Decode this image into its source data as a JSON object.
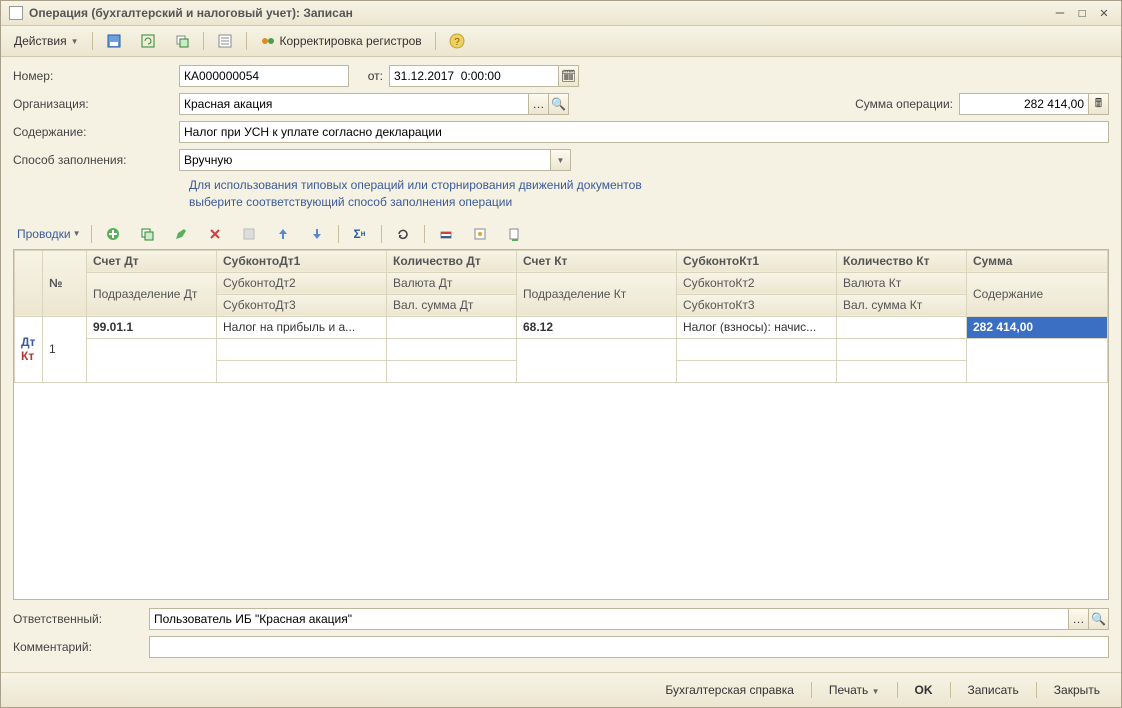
{
  "window": {
    "title": "Операция (бухгалтерский и налоговый учет): Записан"
  },
  "toolbar": {
    "actions": "Действия",
    "registers": "Корректировка регистров"
  },
  "form": {
    "number_label": "Номер:",
    "number_value": "КА000000054",
    "from_label": "от:",
    "date_value": "31.12.2017  0:00:00",
    "org_label": "Организация:",
    "org_value": "Красная акация",
    "sum_label": "Сумма операции:",
    "sum_value": "282 414,00",
    "content_label": "Содержание:",
    "content_value": "Налог при УСН к уплате согласно декларации",
    "fill_label": "Способ заполнения:",
    "fill_value": "Вручную",
    "hint1": "Для использования типовых операций или сторнирования движений документов",
    "hint2": "выберите соответствующий способ заполнения операции"
  },
  "gridtb": {
    "entries": "Проводки"
  },
  "grid": {
    "h_num": "№",
    "h_acc_dt": "Счет Дт",
    "h_sub_dt1": "СубконтоДт1",
    "h_qty_dt": "Количество Дт",
    "h_acc_kt": "Счет Кт",
    "h_sub_kt1": "СубконтоКт1",
    "h_qty_kt": "Количество Кт",
    "h_sum": "Сумма",
    "h_dept_dt": "Подразделение Дт",
    "h_sub_dt2": "СубконтоДт2",
    "h_cur_dt": "Валюта Дт",
    "h_dept_kt": "Подразделение Кт",
    "h_sub_kt2": "СубконтоКт2",
    "h_cur_kt": "Валюта Кт",
    "h_content": "Содержание",
    "h_sub_dt3": "СубконтоДт3",
    "h_valsum_dt": "Вал. сумма Дт",
    "h_sub_kt3": "СубконтоКт3",
    "h_valsum_kt": "Вал. сумма Кт",
    "row": {
      "marker_dt": "Дт",
      "marker_kt": "Кт",
      "num": "1",
      "acc_dt": "99.01.1",
      "sub_dt1": "Налог на прибыль и а...",
      "acc_kt": "68.12",
      "sub_kt1": "Налог (взносы): начис...",
      "sum": "282 414,00"
    }
  },
  "bottom": {
    "resp_label": "Ответственный:",
    "resp_value": "Пользователь ИБ \"Красная акация\"",
    "comment_label": "Комментарий:",
    "comment_value": ""
  },
  "footer": {
    "help": "Бухгалтерская справка",
    "print": "Печать",
    "ok": "OK",
    "save": "Записать",
    "close": "Закрыть"
  }
}
